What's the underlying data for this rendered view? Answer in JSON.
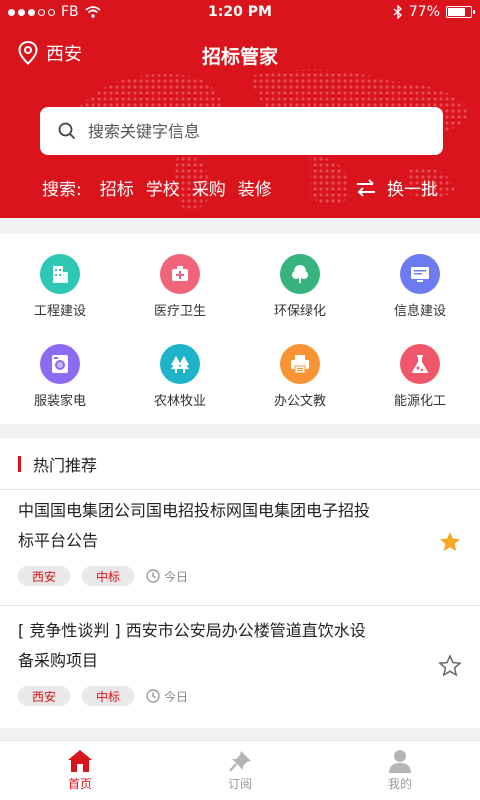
{
  "status": {
    "carrier": "FB",
    "time": "1:20 PM",
    "battery": "77%",
    "battery_level": 0.77
  },
  "header": {
    "location": "西安",
    "title": "招标管家",
    "search_placeholder": "搜索关键字信息",
    "search_label": "搜索:",
    "hot_keywords": [
      "招标",
      "学校",
      "采购",
      "装修"
    ],
    "refresh_label": "换一批"
  },
  "categories": [
    {
      "label": "工程建设",
      "icon": "building-icon",
      "color": "#2ec7b4"
    },
    {
      "label": "医疗卫生",
      "icon": "medical-kit-icon",
      "color": "#f0657a"
    },
    {
      "label": "环保绿化",
      "icon": "tree-icon",
      "color": "#36b37e"
    },
    {
      "label": "信息建设",
      "icon": "monitor-icon",
      "color": "#6c7cf0"
    },
    {
      "label": "服装家电",
      "icon": "washing-machine-icon",
      "color": "#8b6cf0"
    },
    {
      "label": "农林牧业",
      "icon": "forest-icon",
      "color": "#1fb3c9"
    },
    {
      "label": "办公文教",
      "icon": "printer-icon",
      "color": "#f79433"
    },
    {
      "label": "能源化工",
      "icon": "flask-icon",
      "color": "#f0576a"
    }
  ],
  "recommend": {
    "title": "热门推荐",
    "items": [
      {
        "line1": "中国国电集团公司国电招投标网国电集团电子招投",
        "line2": "标平台公告",
        "region": "西安",
        "status": "中标",
        "time": "今日",
        "starred": true
      },
      {
        "line1": "[ 竞争性谈判 ] 西安市公安局办公楼管道直饮水设",
        "line2": "备采购项目",
        "region": "西安",
        "status": "中标",
        "time": "今日",
        "starred": false
      }
    ]
  },
  "tabs": [
    {
      "label": "首页",
      "icon": "home-icon",
      "active": true
    },
    {
      "label": "订阅",
      "icon": "pin-icon",
      "active": false
    },
    {
      "label": "我的",
      "icon": "user-icon",
      "active": false
    }
  ]
}
